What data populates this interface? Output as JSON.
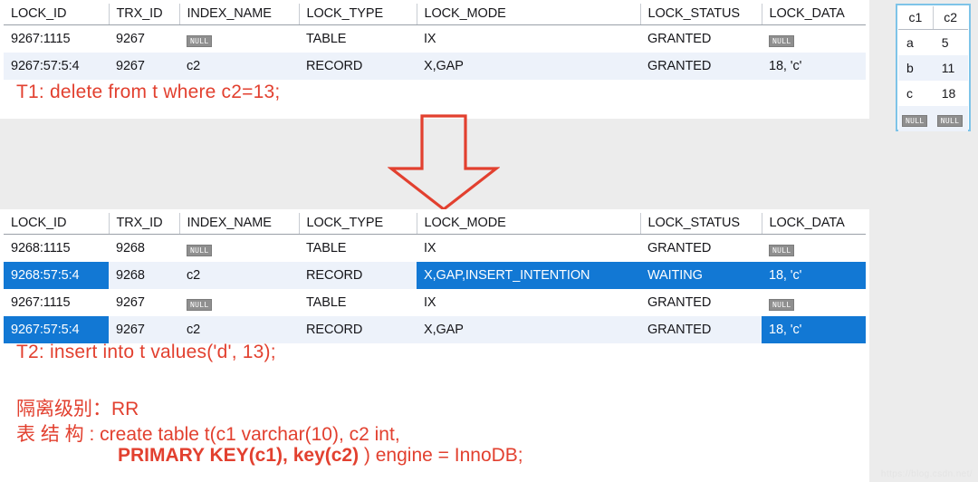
{
  "lock_table": {
    "columns": [
      "LOCK_ID",
      "TRX_ID",
      "INDEX_NAME",
      "LOCK_TYPE",
      "LOCK_MODE",
      "LOCK_STATUS",
      "LOCK_DATA"
    ],
    "null_label": "NULL",
    "top_rows": [
      {
        "lock_id": "9267:1115",
        "trx_id": "9267",
        "index_name": "NULL",
        "lock_type": "TABLE",
        "lock_mode": "IX",
        "lock_status": "GRANTED",
        "lock_data": "NULL"
      },
      {
        "lock_id": "9267:57:5:4",
        "trx_id": "9267",
        "index_name": "c2",
        "lock_type": "RECORD",
        "lock_mode": "X,GAP",
        "lock_status": "GRANTED",
        "lock_data": "18, 'c'"
      }
    ],
    "bottom_rows": [
      {
        "lock_id": "9268:1115",
        "trx_id": "9268",
        "index_name": "NULL",
        "lock_type": "TABLE",
        "lock_mode": "IX",
        "lock_status": "GRANTED",
        "lock_data": "NULL"
      },
      {
        "lock_id": "9268:57:5:4",
        "trx_id": "9268",
        "index_name": "c2",
        "lock_type": "RECORD",
        "lock_mode": "X,GAP,INSERT_INTENTION",
        "lock_status": "WAITING",
        "lock_data": "18, 'c'"
      },
      {
        "lock_id": "9267:1115",
        "trx_id": "9267",
        "index_name": "NULL",
        "lock_type": "TABLE",
        "lock_mode": "IX",
        "lock_status": "GRANTED",
        "lock_data": "NULL"
      },
      {
        "lock_id": "9267:57:5:4",
        "trx_id": "9267",
        "index_name": "c2",
        "lock_type": "RECORD",
        "lock_mode": "X,GAP",
        "lock_status": "GRANTED",
        "lock_data": "18, 'c'"
      }
    ]
  },
  "statements": {
    "t1": "T1:  delete from t where c2=13;",
    "t2": "T2:  insert into t values('d', 13);"
  },
  "notes": {
    "isolation": "隔离级别：RR",
    "schema_line1": "表 结 构 :  create table t(c1 varchar(10), c2 int,",
    "schema_line2_bold": "PRIMARY KEY(c1), key(c2)",
    "schema_line2_tail": " ) engine = InnoDB;"
  },
  "mini_grid": {
    "columns": [
      "c1",
      "c2"
    ],
    "rows": [
      {
        "c1": "a",
        "c2": "5"
      },
      {
        "c1": "b",
        "c2": "11"
      },
      {
        "c1": "c",
        "c2": "18"
      },
      {
        "c1": "NULL",
        "c2": "NULL"
      }
    ],
    "null_label": "NULL"
  },
  "colors": {
    "selection_blue": "#1278d4",
    "statement_red": "#e2402f",
    "alt_row": "#edf2fa",
    "grid_border_blue": "#7ec4e8"
  },
  "watermark": "https://blog.csdn.net/"
}
